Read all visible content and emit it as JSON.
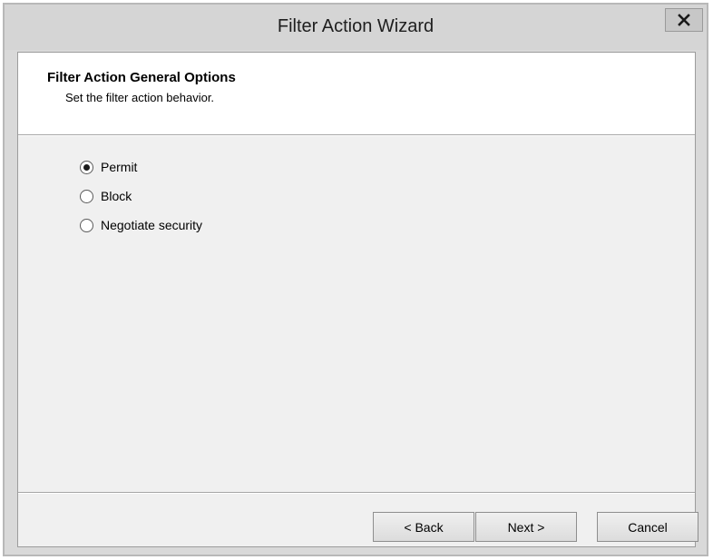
{
  "window": {
    "title": "Filter Action Wizard",
    "close_icon": "close-icon"
  },
  "header": {
    "title": "Filter Action General Options",
    "subtitle": "Set the filter action behavior."
  },
  "options": [
    {
      "label": "Permit",
      "checked": true
    },
    {
      "label": "Block",
      "checked": false
    },
    {
      "label": "Negotiate security",
      "checked": false
    }
  ],
  "buttons": {
    "back": "< Back",
    "next": "Next >",
    "cancel": "Cancel"
  }
}
